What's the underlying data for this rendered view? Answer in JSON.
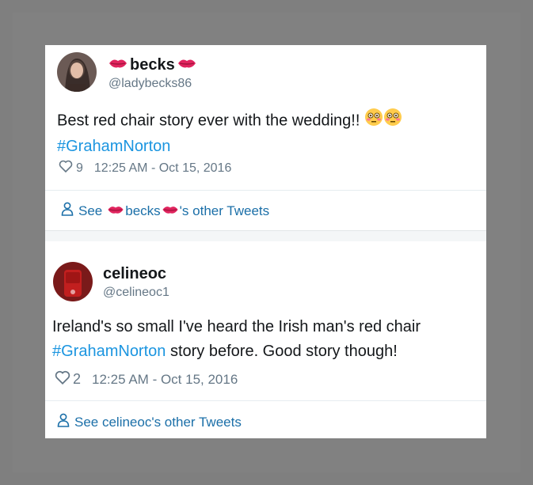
{
  "tweets": [
    {
      "display_name": "becks",
      "handle": "@ladybecks86",
      "text": "Best red chair story ever with the wedding!!",
      "hashtag": "#GrahamNorton",
      "likes": "9",
      "timestamp": "12:25 AM - Oct 15, 2016",
      "see_prefix": "See ",
      "see_name": "becks",
      "see_suffix": "'s other Tweets"
    },
    {
      "display_name": "celineoc",
      "handle": "@celineoc1",
      "text_line1": "Ireland's so small I've heard the Irish man's red chair",
      "hashtag": "#GrahamNorton",
      "text_rest": " story before. Good story though!",
      "likes": "2",
      "timestamp": "12:25 AM - Oct 15, 2016",
      "see_link": "See celineoc's other Tweets"
    }
  ],
  "colors": {
    "link": "#1b95e0",
    "text": "#14171a",
    "muted": "#657786",
    "lips": "#e0245e"
  }
}
